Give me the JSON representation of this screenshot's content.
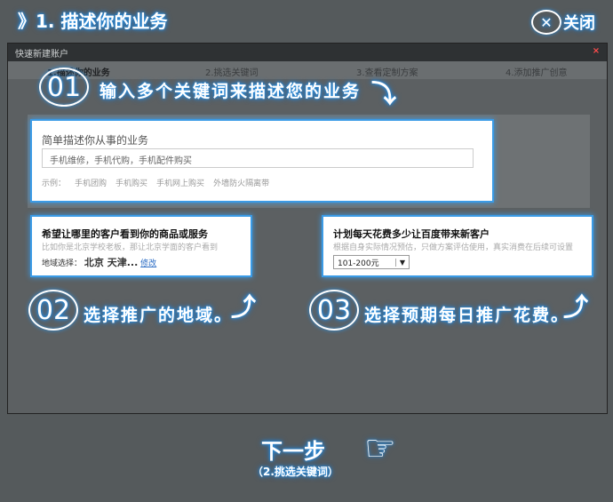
{
  "header": {
    "title": "》1. 描述你的业务",
    "close_icon": "close-icon",
    "close_label": "关闭"
  },
  "dialog": {
    "title": "快速新建账户",
    "close_glyph": "×",
    "steps": [
      "1.描述你的业务",
      "2.挑选关键词",
      "3.查看定制方案",
      "4.添加推广创意"
    ]
  },
  "annotations": {
    "step1_num": "01",
    "step1_text": "输入多个关键词来描述您的业务",
    "step2_num": "02",
    "step2_text": "选择推广的地域。",
    "step3_num": "03",
    "step3_text": "选择预期每日推广花费。"
  },
  "business_card": {
    "title": "简单描述你从事的业务",
    "input_value": "手机维修，手机代购，手机配件购买",
    "examples_label": "示例：",
    "examples": [
      "手机团购",
      "手机购买",
      "手机网上购买",
      "外墙防火隔离带"
    ]
  },
  "region_card": {
    "title": "希望让哪里的客户看到你的商品或服务",
    "subtitle": "比如你是北京学校老板，那让北京学面的客户看到",
    "region_label": "地域选择：",
    "region_value": "北京 天津...",
    "modify_link": "修改"
  },
  "budget_card": {
    "title": "计划每天花费多少让百度带来新客户",
    "subtitle": "根据自身实际情况预估，只做方案评估使用，真实消费在后续可设置",
    "select_value": "101-200元"
  },
  "next": {
    "label": "下一步",
    "sub": "（2.挑选关键词）",
    "hand_icon": "pointing-hand-icon"
  },
  "colors": {
    "glow": "#2b8fe0",
    "card_border": "#3b9be6",
    "backdrop": "#555a5c"
  }
}
